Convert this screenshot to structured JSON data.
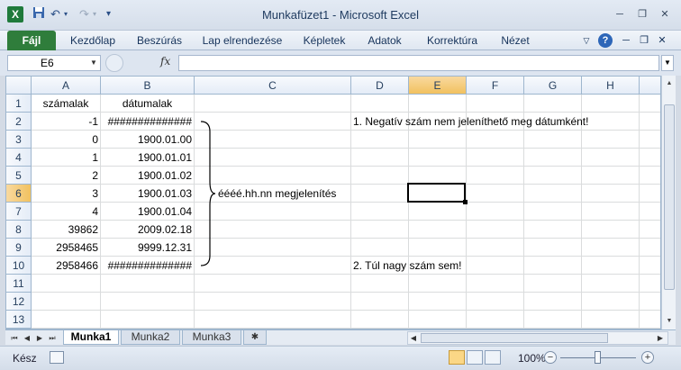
{
  "window": {
    "title": "Munkafüzet1 - Microsoft Excel",
    "app_icon": "excel-icon",
    "controls": [
      "minimize-icon",
      "restore-icon",
      "close-icon"
    ]
  },
  "ribbon": {
    "tabs": [
      "Fájl",
      "Kezdőlap",
      "Beszúrás",
      "Lap elrendezése",
      "Képletek",
      "Adatok",
      "Korrektúra",
      "Nézet"
    ]
  },
  "formula_bar": {
    "name_box": "E6",
    "fx_label": "fx",
    "formula": ""
  },
  "grid": {
    "columns": [
      "A",
      "B",
      "C",
      "D",
      "E",
      "F",
      "G",
      "H"
    ],
    "rows": [
      "1",
      "2",
      "3",
      "4",
      "5",
      "6",
      "7",
      "8",
      "9",
      "10",
      "11",
      "12",
      "13"
    ],
    "selected_cell": "E6",
    "cells": {
      "A1": "számalak",
      "B1": "dátumalak",
      "A2": "-1",
      "B2": "##############",
      "A3": "0",
      "B3": "1900.01.00",
      "A4": "1",
      "B4": "1900.01.01",
      "A5": "2",
      "B5": "1900.01.02",
      "A6": "3",
      "B6": "1900.01.03",
      "C6": "éééé.hh.nn megjelenítés",
      "A7": "4",
      "B7": "1900.01.04",
      "A8": "39862",
      "B8": "2009.02.18",
      "A9": "2958465",
      "B9": "9999.12.31",
      "A10": "2958466",
      "B10": "##############",
      "D2": "1. Negatív szám nem jeleníthető meg dátumként!",
      "D10": "2. Túl nagy szám sem!"
    }
  },
  "sheets": {
    "tabs": [
      "Munka1",
      "Munka2",
      "Munka3"
    ],
    "active": "Munka1"
  },
  "status": {
    "ready": "Kész",
    "zoom": "100%"
  }
}
